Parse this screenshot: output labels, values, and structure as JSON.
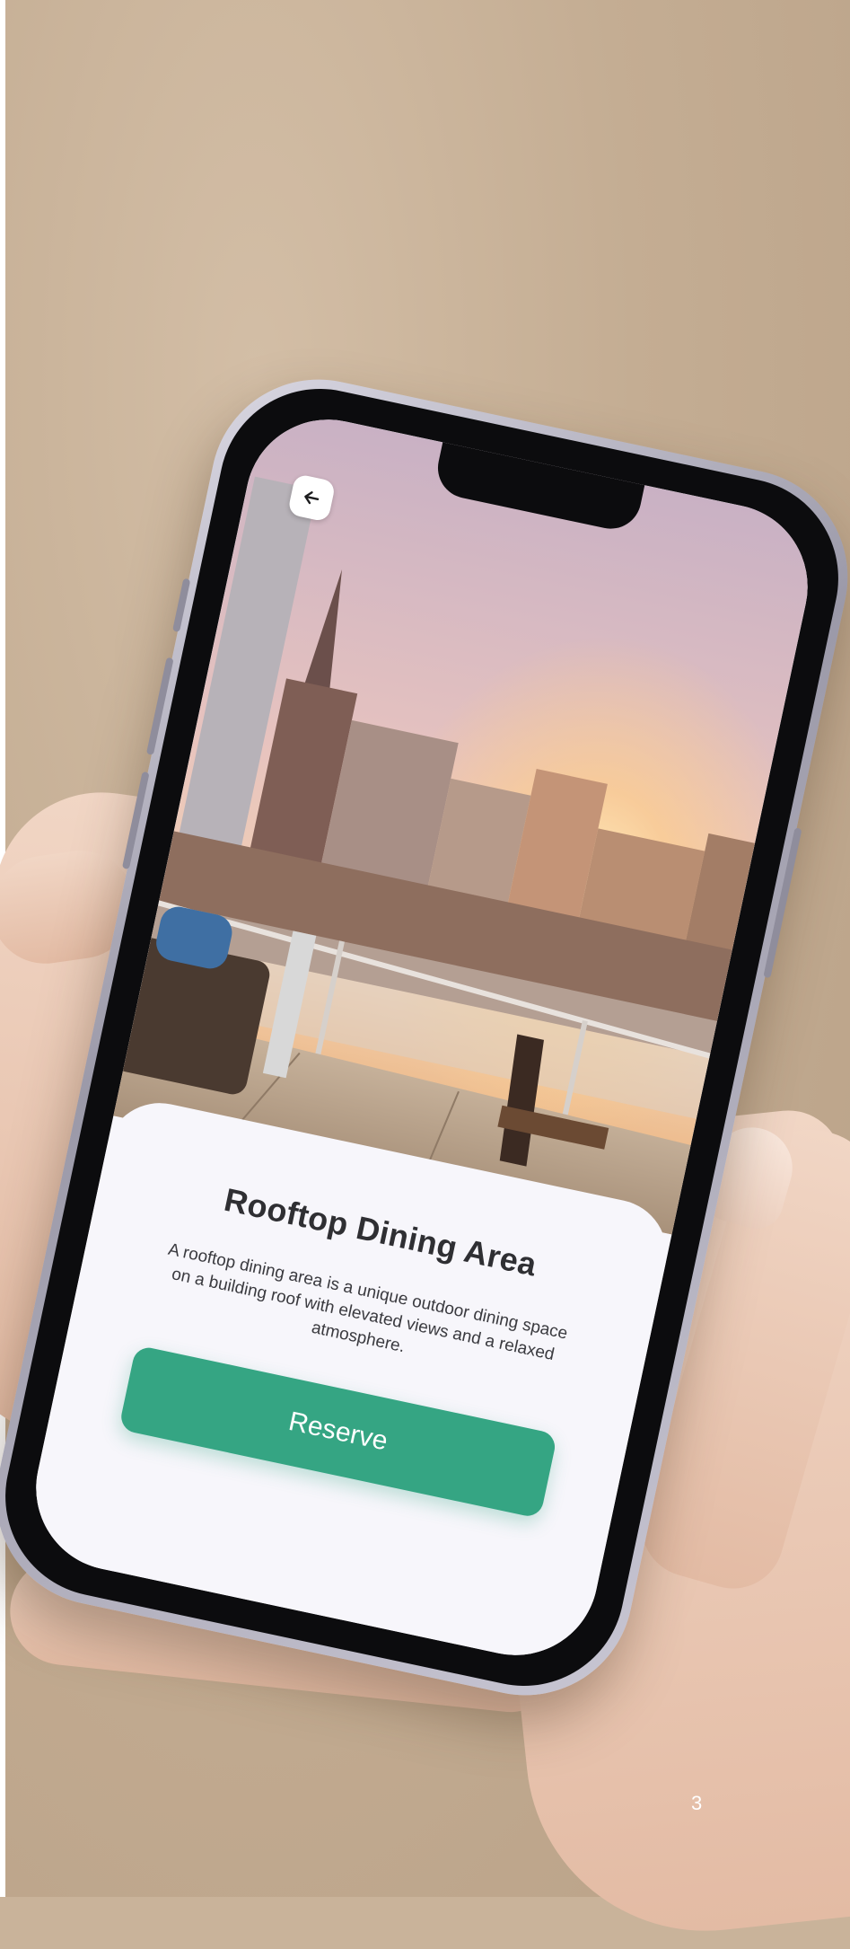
{
  "screen": {
    "title": "Rooftop Dining Area",
    "description": "A rooftop dining area is a unique outdoor dining space on a building roof with elevated views and a relaxed atmosphere.",
    "reserve_label": "Reserve",
    "back_icon": "arrow-left-icon"
  },
  "page_number": "3",
  "colors": {
    "accent": "#35a583",
    "card_background": "#f7f6fb",
    "title_text": "#2f2f33"
  }
}
